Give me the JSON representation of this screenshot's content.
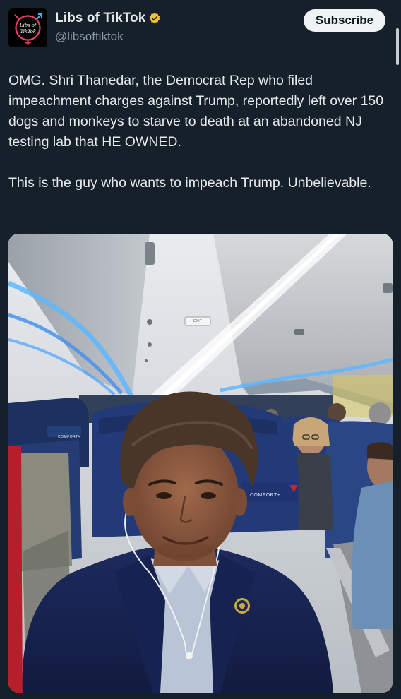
{
  "account": {
    "avatar_text_line1": "Libs of",
    "avatar_text_line2": "TikTok",
    "display_name": "Libs of TikTok",
    "handle": "@libsoftiktok",
    "verified": true,
    "verified_color": "#f4c23a"
  },
  "subscribe_label": "Subscribe",
  "tweet": {
    "paragraph1": "OMG. Shri Thanedar, the Democrat Rep who filed impeachment charges against Trump, reportedly left over 150 dogs and monkeys to starve to death at an abandoned NJ testing lab that HE OWNED.",
    "paragraph2": "This is the guy who wants to impeach Trump. Unbelievable."
  },
  "photo": {
    "seat_label_1": "COMFORT+",
    "seat_label_2": "COMFORT+",
    "exit_sign": "EXIT"
  },
  "colors": {
    "background": "#15202b",
    "text": "#e7e9ea",
    "secondary_text": "#8b98a5",
    "subscribe_bg": "#eff3f4"
  }
}
